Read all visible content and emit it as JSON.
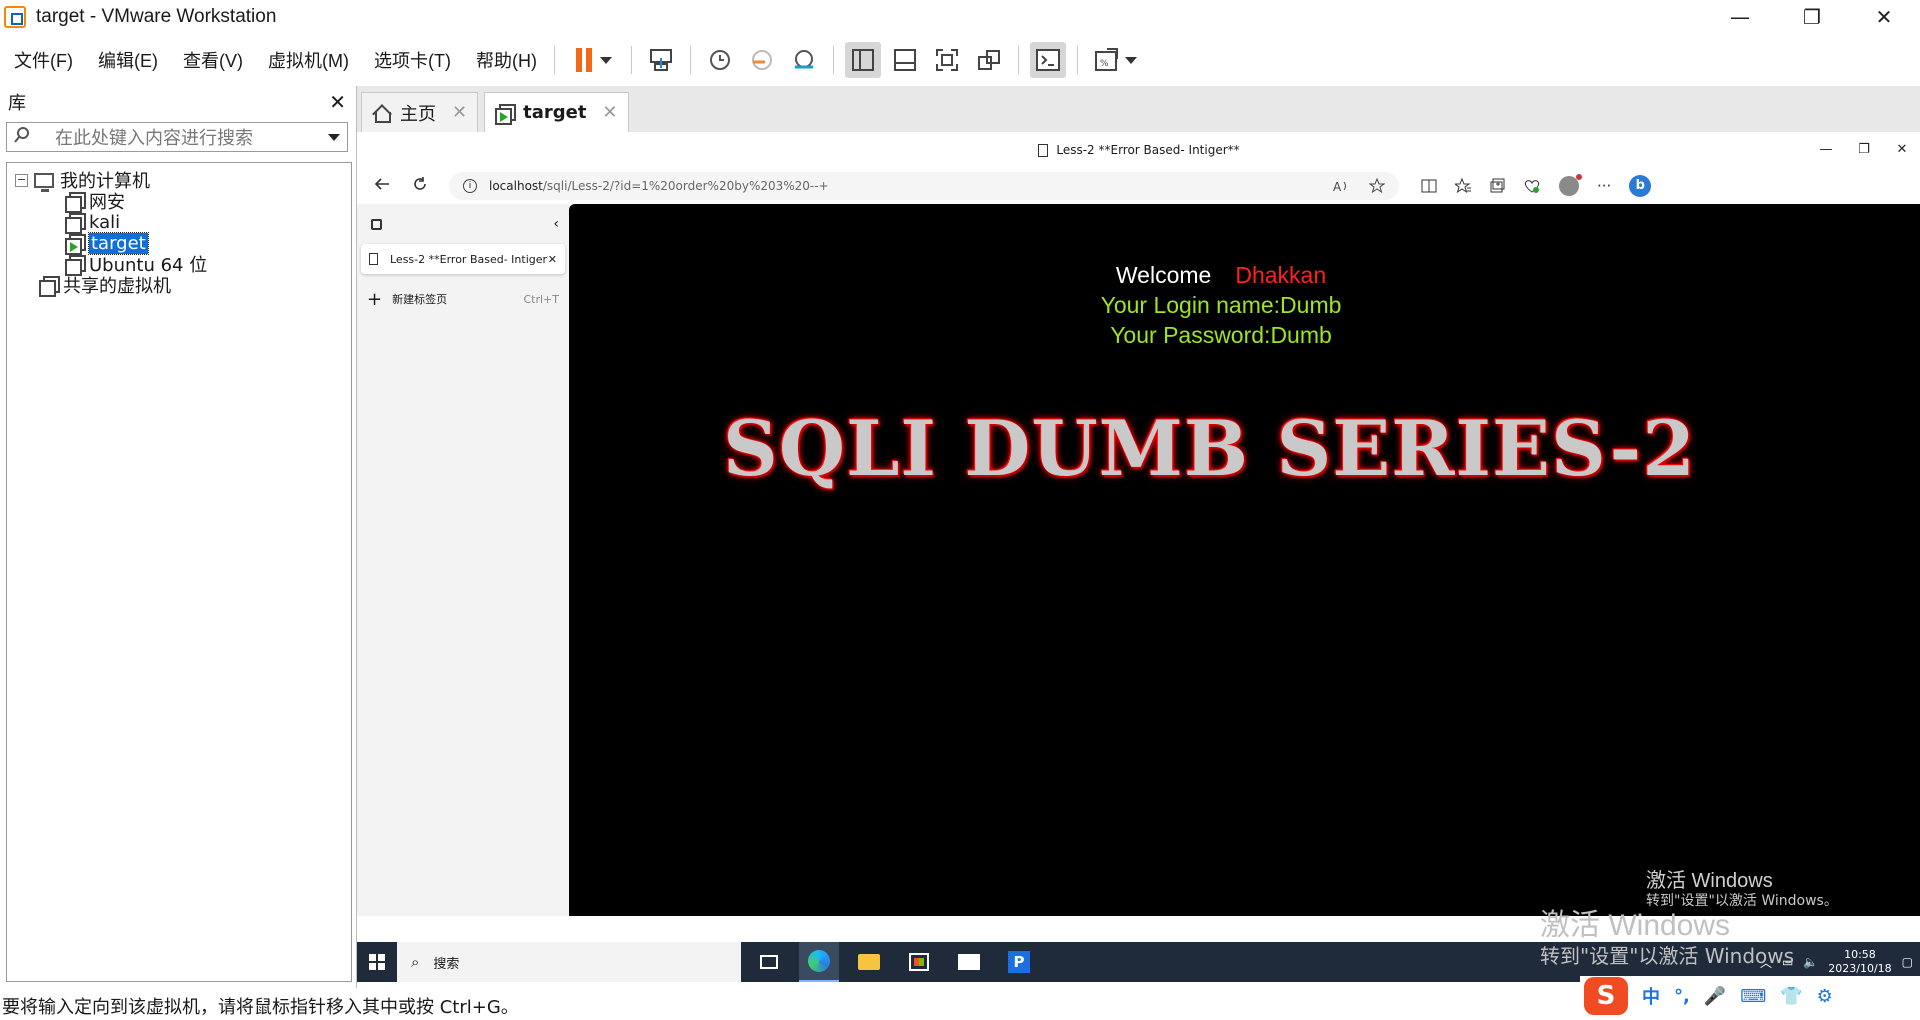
{
  "window": {
    "title": "target - VMware Workstation",
    "controls": {
      "minimize": "—",
      "restore": "❐",
      "close": "✕"
    }
  },
  "menu": {
    "items": [
      "文件(F)",
      "编辑(E)",
      "查看(V)",
      "虚拟机(M)",
      "选项卡(T)",
      "帮助(H)"
    ]
  },
  "library": {
    "title": "库",
    "close": "✕",
    "search_placeholder": "在此处键入内容进行搜索",
    "tree": {
      "root": "我的计算机",
      "collapse_symbol": "−",
      "vms": [
        "网安",
        "kali",
        "target",
        "Ubuntu 64 位"
      ],
      "selected": "target",
      "shared": "共享的虚拟机"
    }
  },
  "tabs": {
    "home_label": "主页",
    "target_label": "target",
    "close": "✕"
  },
  "edge": {
    "page_title": "Less-2 **Error Based- Intiger**",
    "url_host": "localhost",
    "url_path": "/sqli/Less-2/?id=1%20order%20by%203%20--+",
    "controls": {
      "minimize": "—",
      "restore": "❐",
      "close": "✕"
    },
    "vertical_tabs": {
      "tab_label": "Less-2 **Error Based- Intiger**",
      "new_tab_label": "新建标签页",
      "new_tab_shortcut": "Ctrl+T"
    },
    "bing_label": "b"
  },
  "page": {
    "welcome": "Welcome",
    "user": "Dhakkan",
    "login_name": "Your Login name:Dumb",
    "password": "Your Password:Dumb",
    "banner": "SQLI DUMB SERIES-2",
    "colors": {
      "welcome": "#ffffff",
      "user": "#ff2020",
      "info": "#9de51f",
      "background": "#000000"
    }
  },
  "watermark": {
    "small_title": "激活 Windows",
    "small_sub": "转到\"设置\"以激活 Windows。",
    "large_title": "激活 Windows",
    "large_sub": "转到\"设置\"以激活 Windows"
  },
  "guest_taskbar": {
    "search_label": "搜索",
    "p_app_label": "P",
    "time": "10:58",
    "date": "2023/10/18"
  },
  "ime": {
    "logo": "S",
    "items": [
      "中",
      "°,",
      "🎤",
      "⌨",
      "👕",
      "⚙"
    ]
  },
  "status": {
    "text": "要将输入定向到该虚拟机，请将鼠标指针移入其中或按 Ctrl+G。"
  }
}
